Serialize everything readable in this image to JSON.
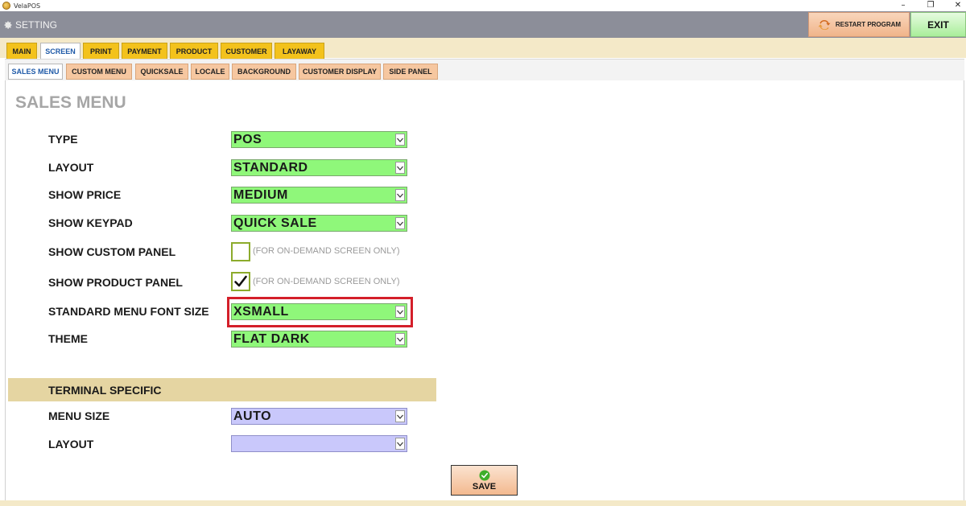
{
  "window": {
    "title": "VelaPOS"
  },
  "header": {
    "title": "SETTING",
    "restart_label": "RESTART PROGRAM",
    "exit_label": "EXIT"
  },
  "main_tabs": [
    {
      "label": "MAIN",
      "active": false
    },
    {
      "label": "SCREEN",
      "active": true
    },
    {
      "label": "PRINT",
      "active": false
    },
    {
      "label": "PAYMENT",
      "active": false
    },
    {
      "label": "PRODUCT",
      "active": false
    },
    {
      "label": "CUSTOMER",
      "active": false
    },
    {
      "label": "LAYAWAY",
      "active": false
    }
  ],
  "sub_tabs": [
    {
      "label": "SALES MENU",
      "active": true
    },
    {
      "label": "CUSTOM MENU",
      "active": false
    },
    {
      "label": "QUICKSALE",
      "active": false
    },
    {
      "label": "LOCALE",
      "active": false
    },
    {
      "label": "BACKGROUND",
      "active": false
    },
    {
      "label": "CUSTOMER DISPLAY",
      "active": false
    },
    {
      "label": "SIDE PANEL",
      "active": false
    }
  ],
  "page": {
    "title": "SALES MENU"
  },
  "settings": {
    "type": {
      "label": "TYPE",
      "value": "POS"
    },
    "layout": {
      "label": "LAYOUT",
      "value": "STANDARD"
    },
    "show_price": {
      "label": "SHOW PRICE",
      "value": "MEDIUM"
    },
    "show_keypad": {
      "label": "SHOW KEYPAD",
      "value": "QUICK SALE"
    },
    "show_custom_panel": {
      "label": "SHOW CUSTOM PANEL",
      "checked": false,
      "note": "(FOR ON-DEMAND SCREEN ONLY)"
    },
    "show_product_panel": {
      "label": "SHOW PRODUCT PANEL",
      "checked": true,
      "note": "(FOR ON-DEMAND SCREEN ONLY)"
    },
    "standard_menu_font_size": {
      "label": "STANDARD MENU FONT SIZE",
      "value": "XSMALL"
    },
    "theme": {
      "label": "THEME",
      "value": "FLAT DARK"
    }
  },
  "terminal": {
    "section_title": "TERMINAL SPECIFIC",
    "menu_size": {
      "label": "MENU SIZE",
      "value": "AUTO"
    },
    "layout": {
      "label": "LAYOUT",
      "value": ""
    }
  },
  "save_label": "SAVE",
  "colors": {
    "select_green": "#8ff77a",
    "select_purple": "#c9c8fb",
    "highlight": "#d41f2a",
    "tab_yellow": "#f3c21c",
    "tab_orange": "#f6c7a0",
    "section_bar": "#e5d5a2",
    "header_gray": "#8c8e99"
  }
}
